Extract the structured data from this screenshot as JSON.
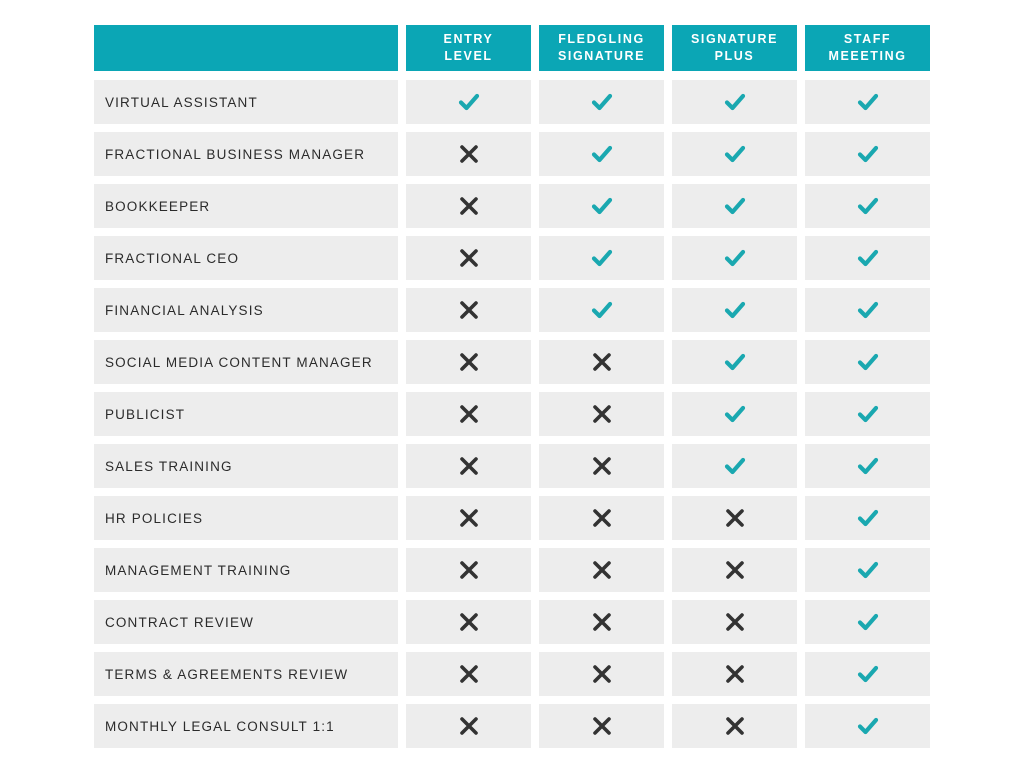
{
  "table": {
    "corner_label": "",
    "columns": [
      {
        "id": "entry-level",
        "label": "ENTRY\nLEVEL"
      },
      {
        "id": "fledgling-signature",
        "label": "FLEDGLING\nSIGNATURE"
      },
      {
        "id": "signature-plus",
        "label": "SIGNATURE\nPLUS"
      },
      {
        "id": "staff-meeeting",
        "label": "STAFF\nMEEETING"
      }
    ],
    "marks": {
      "yes": "check-icon",
      "no": "cross-icon"
    },
    "colors": {
      "header_teal": "#0ba6b5",
      "row_gray": "#ededed",
      "check_teal": "#1aa8b0",
      "cross_dark": "#333333",
      "page_background": "#ffffff",
      "header_text": "#ffffff",
      "feature_text": "#2b2b2b"
    },
    "rows": [
      {
        "feature": "VIRTUAL ASSISTANT",
        "values": [
          "yes",
          "yes",
          "yes",
          "yes"
        ]
      },
      {
        "feature": "FRACTIONAL BUSINESS MANAGER",
        "values": [
          "no",
          "yes",
          "yes",
          "yes"
        ]
      },
      {
        "feature": "BOOKKEEPER",
        "values": [
          "no",
          "yes",
          "yes",
          "yes"
        ]
      },
      {
        "feature": "FRACTIONAL CEO",
        "values": [
          "no",
          "yes",
          "yes",
          "yes"
        ]
      },
      {
        "feature": "FINANCIAL ANALYSIS",
        "values": [
          "no",
          "yes",
          "yes",
          "yes"
        ]
      },
      {
        "feature": "SOCIAL MEDIA CONTENT MANAGER",
        "values": [
          "no",
          "no",
          "yes",
          "yes"
        ]
      },
      {
        "feature": "PUBLICIST",
        "values": [
          "no",
          "no",
          "yes",
          "yes"
        ]
      },
      {
        "feature": "SALES TRAINING",
        "values": [
          "no",
          "no",
          "yes",
          "yes"
        ]
      },
      {
        "feature": "HR POLICIES",
        "values": [
          "no",
          "no",
          "no",
          "yes"
        ]
      },
      {
        "feature": "MANAGEMENT TRAINING",
        "values": [
          "no",
          "no",
          "no",
          "yes"
        ]
      },
      {
        "feature": "CONTRACT REVIEW",
        "values": [
          "no",
          "no",
          "no",
          "yes"
        ]
      },
      {
        "feature": "TERMS & AGREEMENTS REVIEW",
        "values": [
          "no",
          "no",
          "no",
          "yes"
        ]
      },
      {
        "feature": "MONTHLY LEGAL CONSULT 1:1",
        "values": [
          "no",
          "no",
          "no",
          "yes"
        ]
      }
    ]
  }
}
